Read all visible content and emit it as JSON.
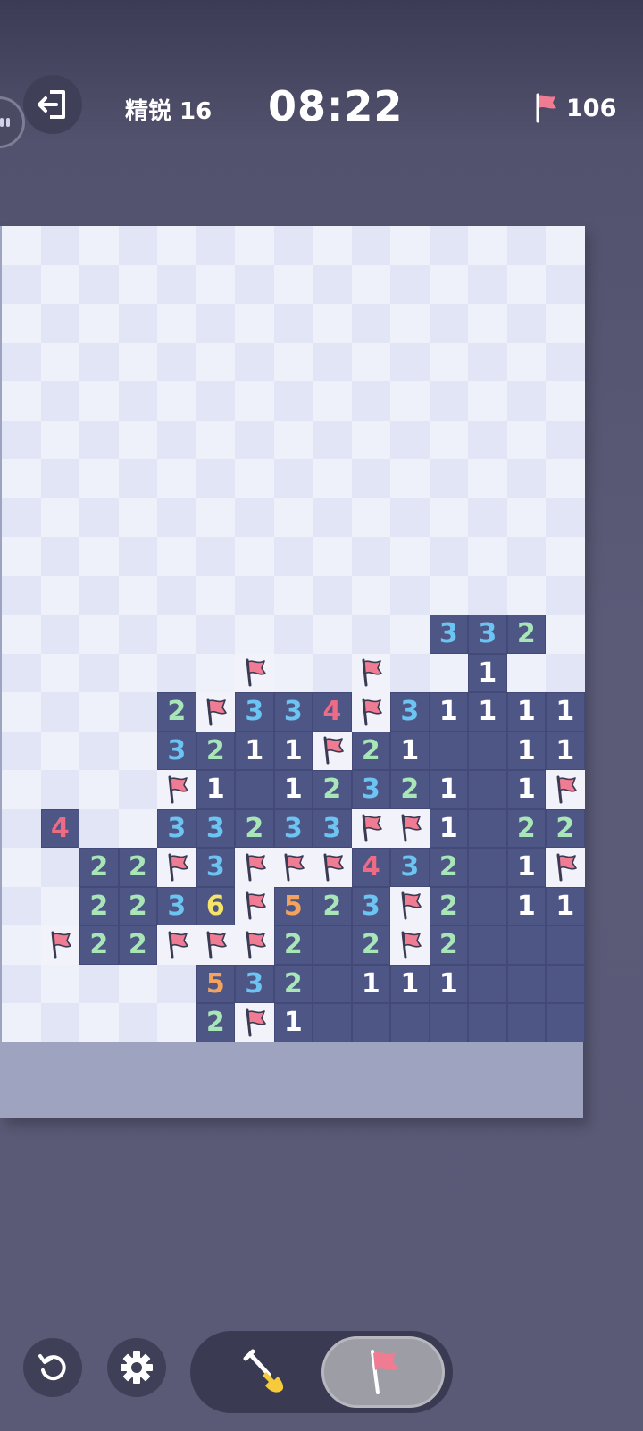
{
  "header": {
    "level_label": "精锐 16",
    "timer": "08:22",
    "flags_remaining": "106"
  },
  "icons": {
    "exit": "exit-door-icon",
    "avatar": "avatar-icon",
    "flag": "flag-icon",
    "undo": "undo-icon",
    "settings": "gear-icon",
    "dig": "shovel-icon"
  },
  "colors": {
    "open_cell": "#4e5685",
    "covered_light": "#eef0fa",
    "covered_dark": "#e2e5f6",
    "flag": "#f07c94",
    "n1": "#ffffff",
    "n2": "#a8e6b8",
    "n3": "#6cc4f2",
    "n4": "#ee6b86",
    "n5": "#f4a35e",
    "n6": "#f6e36a"
  },
  "board": {
    "legend": "#=covered, F=flag, .=open empty, digit=open number",
    "rows": [
      "###############",
      "###############",
      "###############",
      "###############",
      "###############",
      "###############",
      "###############",
      "###############",
      "###############",
      "###############",
      "###########332#",
      "######F##F##1##",
      "####2F334F31111",
      "####3211F21..11",
      "####F1.12321.1F",
      "#4##33233FF1.22",
      "##22F3FFF432.1F",
      "##2236F523F2.11",
      "#F22FFF2.2F2...",
      "#####532.111...",
      "#####2F1......."
    ]
  },
  "toolbar": {
    "selected_mode": "flag"
  }
}
